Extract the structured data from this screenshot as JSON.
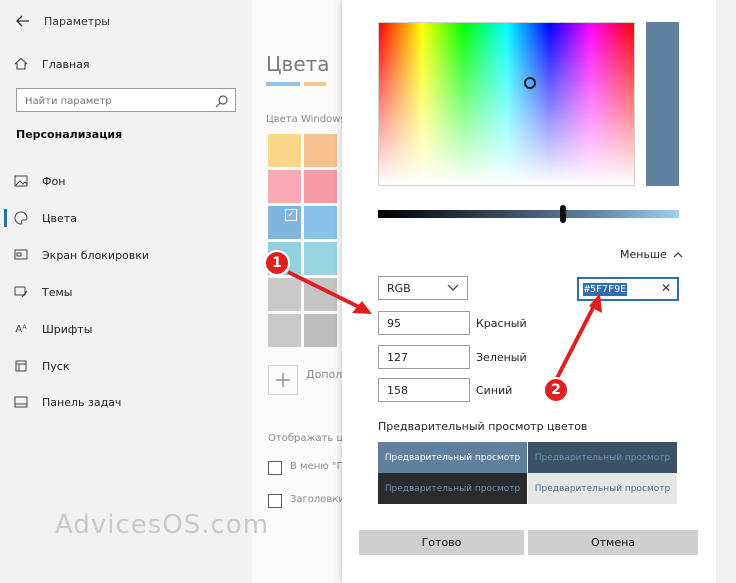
{
  "window": {
    "title": "Параметры"
  },
  "sidebar": {
    "home_label": "Главная",
    "search_placeholder": "Найти параметр",
    "section_title": "Персонализация",
    "items": [
      {
        "label": "Фон",
        "icon": "image-icon"
      },
      {
        "label": "Цвета",
        "icon": "palette-icon",
        "selected": true
      },
      {
        "label": "Экран блокировки",
        "icon": "lock-screen-icon"
      },
      {
        "label": "Темы",
        "icon": "brush-icon"
      },
      {
        "label": "Шрифты",
        "icon": "font-icon"
      },
      {
        "label": "Пуск",
        "icon": "start-icon"
      },
      {
        "label": "Панель задач",
        "icon": "taskbar-icon"
      }
    ]
  },
  "colors_page": {
    "title": "Цвета",
    "windows_colors_label": "Цвета Windows",
    "add_color_label": "Допол",
    "show_accent_label": "Отображать цве",
    "checkbox_start_label": "В меню \"П",
    "checkbox_titlebar_label": "Заголовки"
  },
  "dialog": {
    "current_color_hex": "#5F7F9E",
    "less_label": "Меньше",
    "mode": "RGB",
    "hex_value": "#5F7F9E",
    "channels": [
      {
        "value": "95",
        "label": "Красный"
      },
      {
        "value": "127",
        "label": "Зеленый"
      },
      {
        "value": "158",
        "label": "Синий"
      }
    ],
    "preview_title": "Предварительный просмотр цветов",
    "preview_tiles": [
      {
        "text": "Предварительный просмотр",
        "bg": "#5f7f9e",
        "fg": "#ffffff"
      },
      {
        "text": "Предварительный просмотр",
        "bg": "#3e5265",
        "fg": "#6a93bc"
      },
      {
        "text": "Предварительный просмотр",
        "bg": "#2b2b2b",
        "fg": "#6a93bc"
      },
      {
        "text": "Предварительный просмотр",
        "bg": "#e6e6e6",
        "fg": "#4b6e90"
      }
    ],
    "done_label": "Готово",
    "cancel_label": "Отмена"
  },
  "annotations": {
    "badge_1": "1",
    "badge_2": "2"
  },
  "watermark": "AdvicesOS.com"
}
